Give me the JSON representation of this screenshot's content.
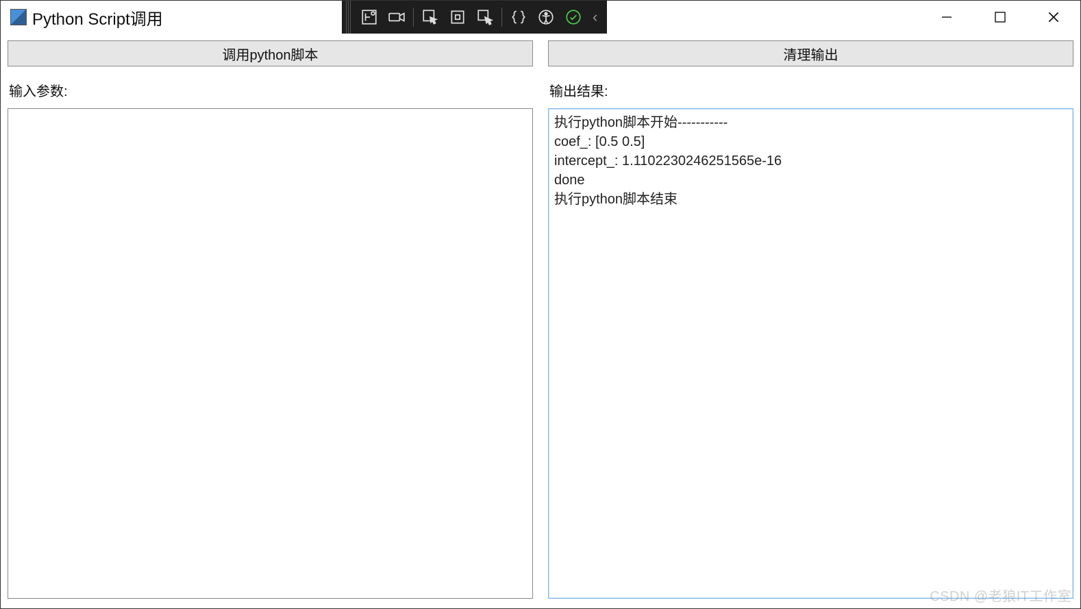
{
  "window": {
    "title": "Python Script调用",
    "controls": {
      "minimize": "minimize",
      "maximize": "maximize",
      "close": "close"
    }
  },
  "vsbar": {
    "icons": [
      "live-tree-icon",
      "camera-icon",
      "pointer-arrow-icon",
      "focus-box-icon",
      "inspect-icon",
      "braces-icon",
      "accessibility-icon",
      "ok-check-icon"
    ],
    "chevron": "‹"
  },
  "left": {
    "button_label": "调用python脚本",
    "input_label": "输入参数:",
    "input_value": ""
  },
  "right": {
    "button_label": "清理输出",
    "output_label": "输出结果:",
    "output_value": "执行python脚本开始-----------\ncoef_: [0.5 0.5]\nintercept_: 1.1102230246251565e-16\ndone\n执行python脚本结束"
  },
  "watermark": "CSDN @老狼IT工作室"
}
